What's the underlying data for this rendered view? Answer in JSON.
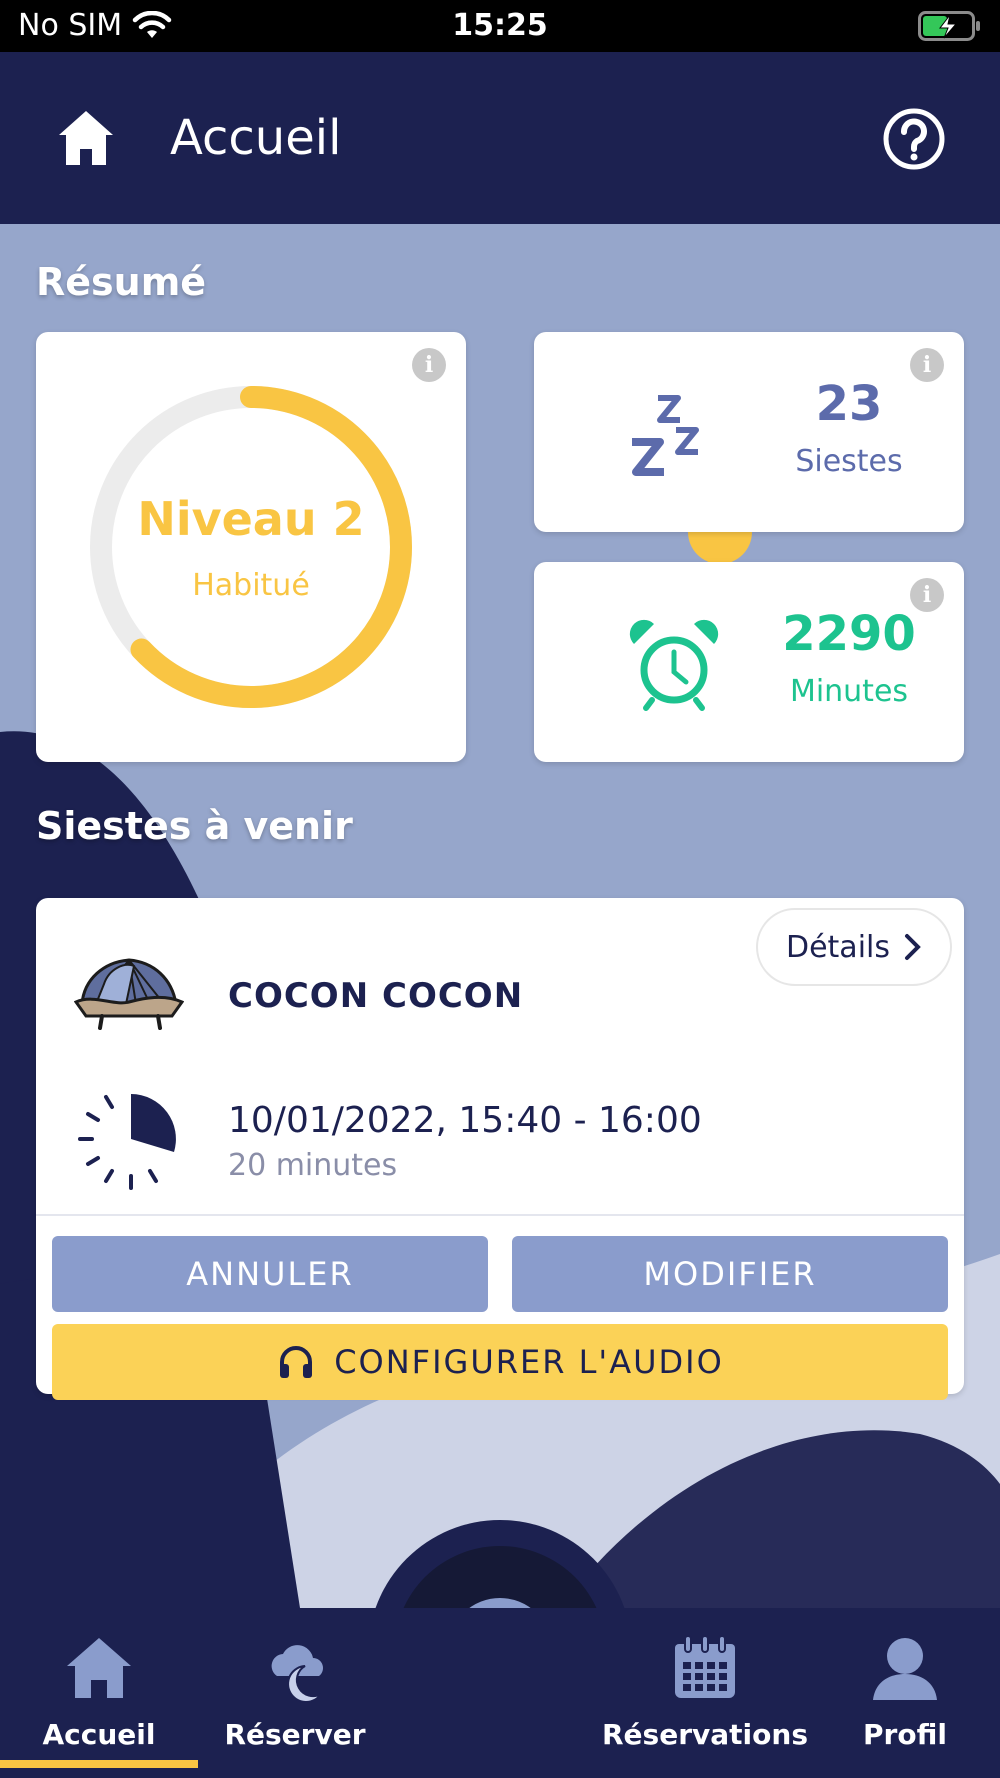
{
  "status_bar": {
    "carrier": "No SIM",
    "time": "15:25"
  },
  "header": {
    "title": "Accueil",
    "home_icon": "home-icon",
    "help_icon": "help-icon"
  },
  "summary": {
    "title": "Résumé",
    "level": {
      "title": "Niveau 2",
      "subtitle": "Habitué",
      "progress": 0.63,
      "color": "#f9c543",
      "track_color": "#ececec"
    },
    "naps": {
      "value": "23",
      "label": "Siestes",
      "color": "#5c6bab",
      "icon": "zzz-icon"
    },
    "minutes": {
      "value": "2290",
      "label": "Minutes",
      "color": "#1dc38f",
      "icon": "alarm-clock-icon"
    }
  },
  "upcoming": {
    "title": "Siestes à venir",
    "booking": {
      "details_label": "Détails",
      "pod_name": "COCON COCON",
      "datetime": "10/01/2022, 15:40 - 16:00",
      "duration": "20 minutes",
      "cancel_label": "ANNULER",
      "modify_label": "MODIFIER",
      "audio_label": "CONFIGURER L'AUDIO"
    }
  },
  "nav": {
    "items": [
      {
        "label": "Accueil",
        "icon": "home-icon",
        "active": true
      },
      {
        "label": "Réserver",
        "icon": "cloud-moon-icon"
      },
      {
        "label": "Réservations",
        "icon": "calendar-icon"
      },
      {
        "label": "Profil",
        "icon": "user-icon"
      }
    ],
    "center_icon": "headphones-icon",
    "accent": "#f9c543"
  }
}
